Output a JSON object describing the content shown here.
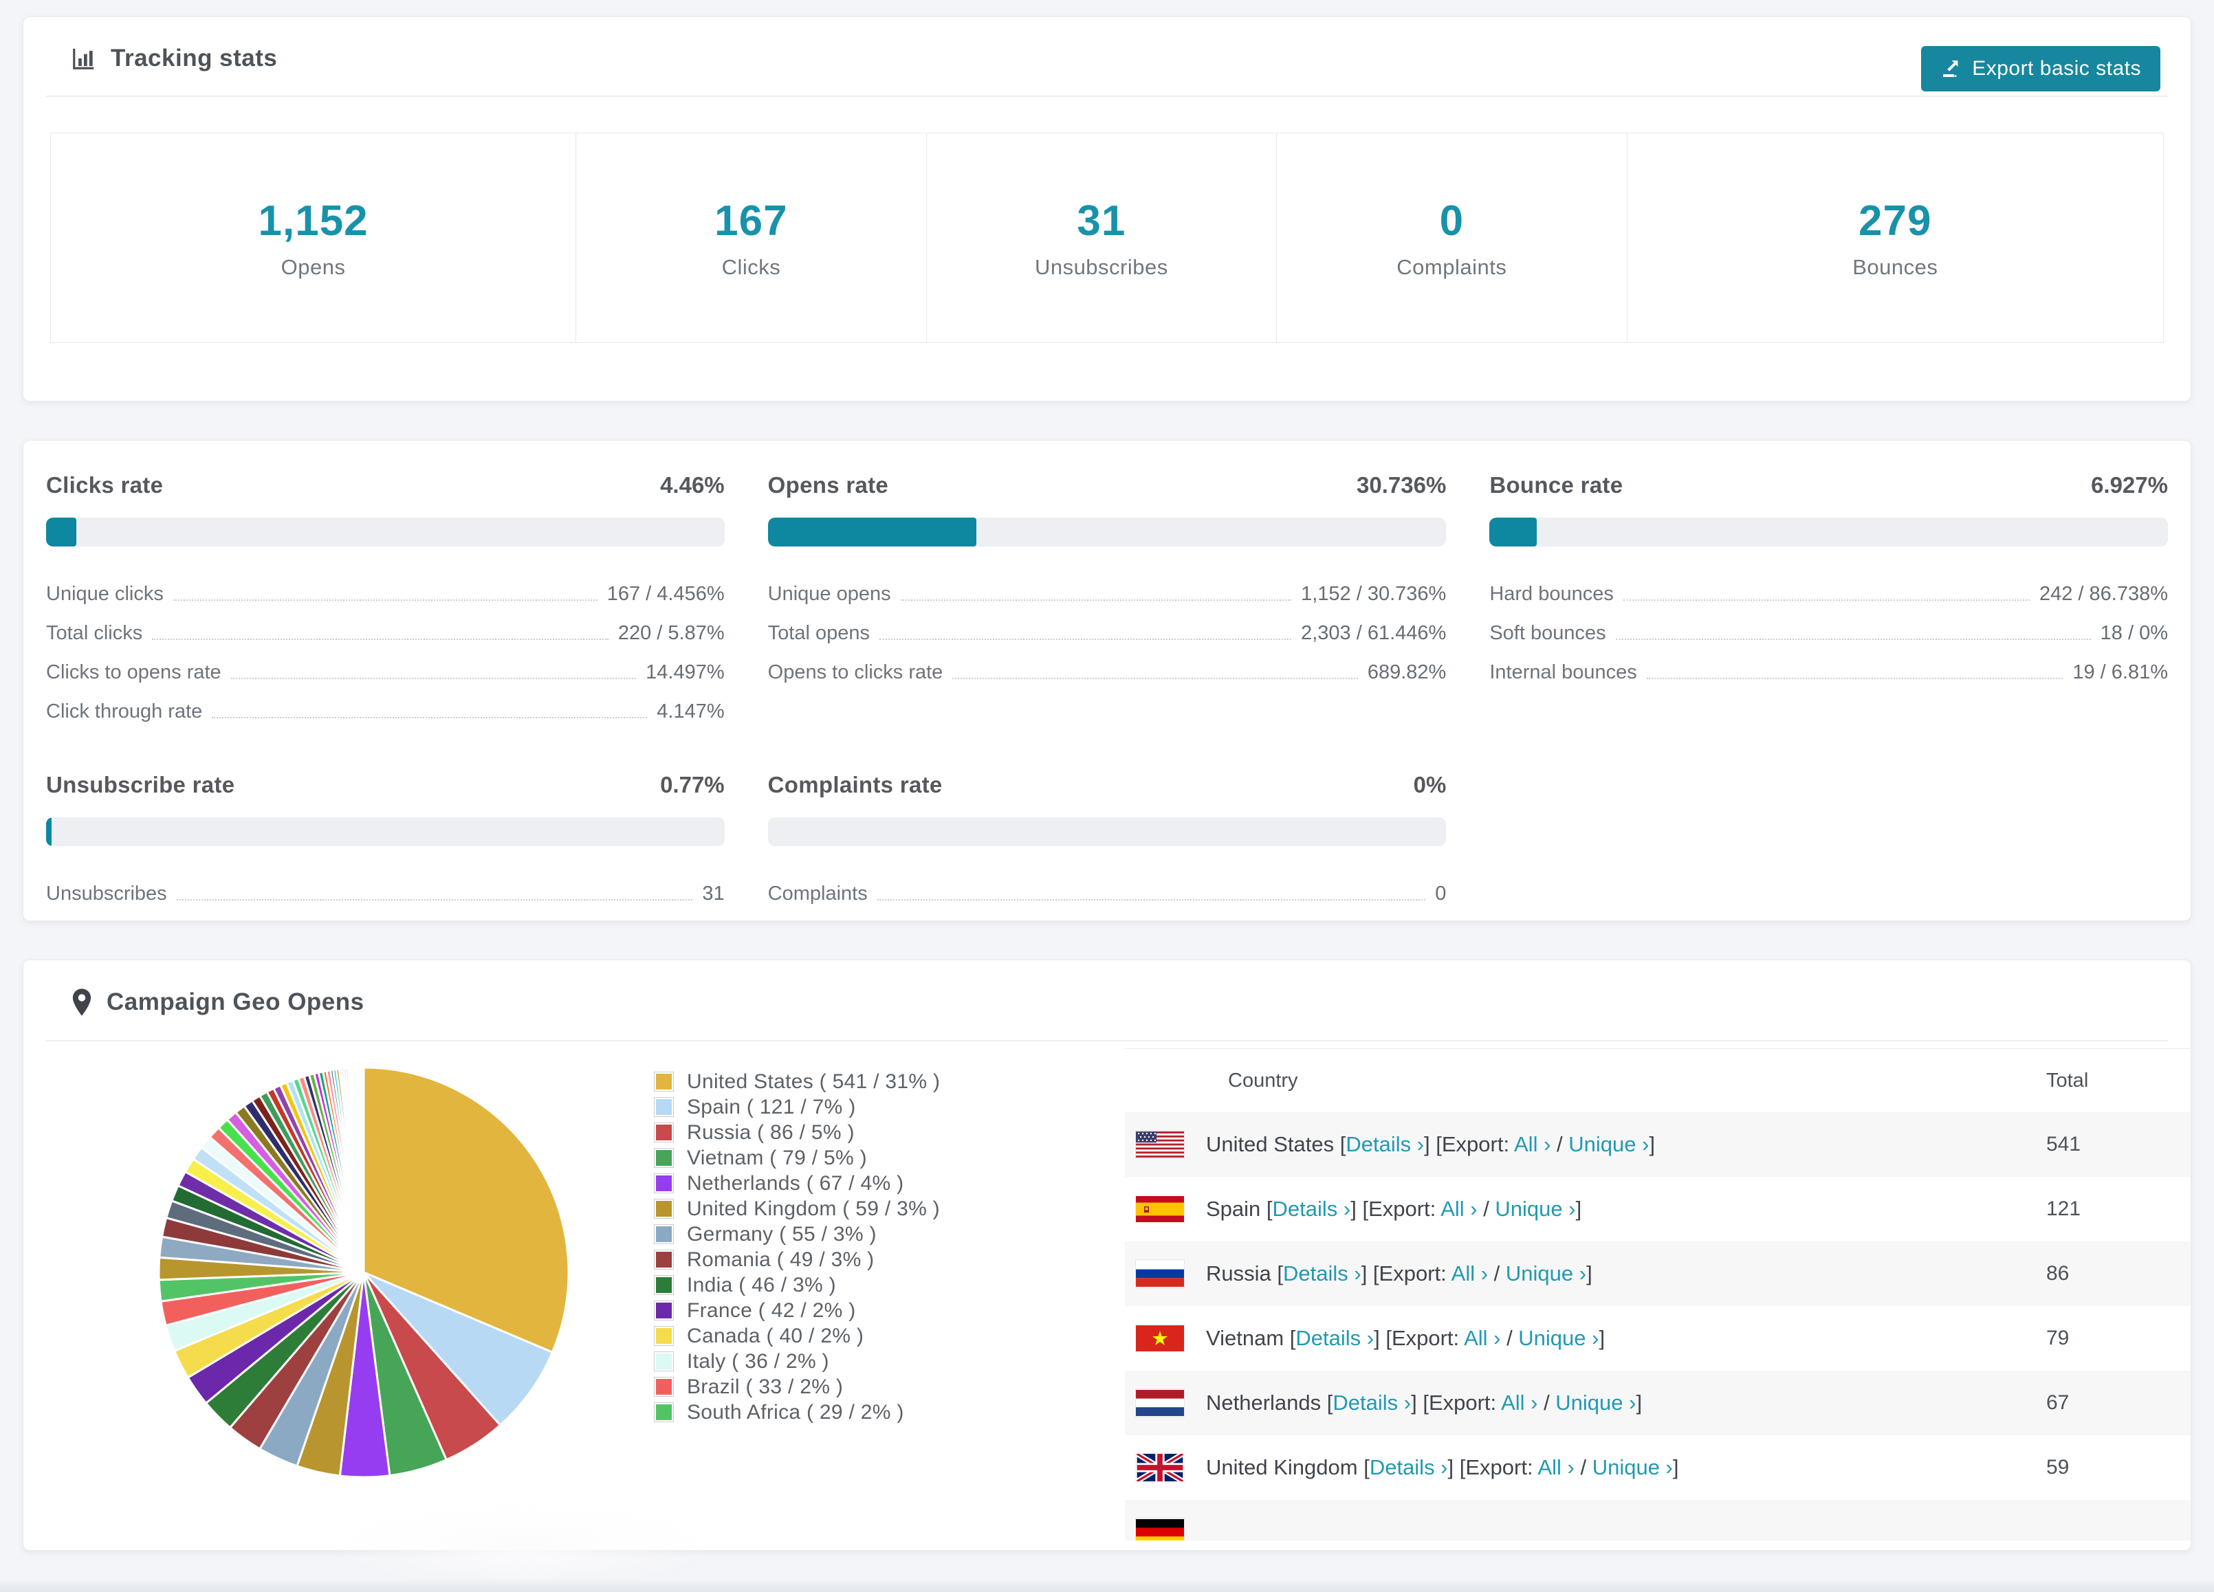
{
  "colors": {
    "accent": "#1792aa",
    "bar_fill": "#0e87a1",
    "button": "#16879e",
    "link": "#2199b1",
    "page_bg": "#f4f5f8",
    "row_stripe": "#f7f7f8"
  },
  "tracking": {
    "title": "Tracking stats",
    "export_button": "Export basic stats",
    "stats": [
      {
        "value": "1,152",
        "label": "Opens"
      },
      {
        "value": "167",
        "label": "Clicks"
      },
      {
        "value": "31",
        "label": "Unsubscribes"
      },
      {
        "value": "0",
        "label": "Complaints"
      },
      {
        "value": "279",
        "label": "Bounces"
      }
    ]
  },
  "rates": [
    {
      "title": "Clicks rate",
      "value": "4.46%",
      "percent": 4.46,
      "rows": [
        {
          "label": "Unique clicks",
          "value": "167 / 4.456%"
        },
        {
          "label": "Total clicks",
          "value": "220 / 5.87%"
        },
        {
          "label": "Clicks to opens rate",
          "value": "14.497%"
        },
        {
          "label": "Click through rate",
          "value": "4.147%"
        }
      ]
    },
    {
      "title": "Opens rate",
      "value": "30.736%",
      "percent": 30.736,
      "rows": [
        {
          "label": "Unique opens",
          "value": "1,152 / 30.736%"
        },
        {
          "label": "Total opens",
          "value": "2,303 / 61.446%"
        },
        {
          "label": "Opens to clicks rate",
          "value": "689.82%"
        }
      ]
    },
    {
      "title": "Bounce rate",
      "value": "6.927%",
      "percent": 6.927,
      "rows": [
        {
          "label": "Hard bounces",
          "value": "242 / 86.738%"
        },
        {
          "label": "Soft bounces",
          "value": "18 / 0%"
        },
        {
          "label": "Internal bounces",
          "value": "19 / 6.81%"
        }
      ]
    },
    {
      "title": "Unsubscribe rate",
      "value": "0.77%",
      "percent": 0.77,
      "rows": [
        {
          "label": "Unsubscribes",
          "value": "31"
        }
      ]
    },
    {
      "title": "Complaints rate",
      "value": "0%",
      "percent": 0,
      "rows": [
        {
          "label": "Complaints",
          "value": "0"
        }
      ]
    }
  ],
  "geo": {
    "title": "Campaign Geo Opens",
    "table": {
      "col_country": "Country",
      "col_total": "Total",
      "tokens": {
        "bracket_open": "[",
        "bracket_close": "]",
        "details": "Details ›",
        "export_word": "Export:",
        "all": "All ›",
        "slash": "/",
        "unique": "Unique ›"
      },
      "rows": [
        {
          "flag": "us",
          "country": "United States",
          "total": "541"
        },
        {
          "flag": "es",
          "country": "Spain",
          "total": "121"
        },
        {
          "flag": "ru",
          "country": "Russia",
          "total": "86"
        },
        {
          "flag": "vn",
          "country": "Vietnam",
          "total": "79"
        },
        {
          "flag": "nl",
          "country": "Netherlands",
          "total": "67"
        },
        {
          "flag": "gb",
          "country": "United Kingdom",
          "total": "59"
        },
        {
          "flag": "de",
          "country": "",
          "total": ""
        }
      ]
    }
  },
  "chart_data": {
    "type": "pie",
    "title": "Campaign Geo Opens",
    "legend_position": "right",
    "start_angle_deg": -90,
    "direction": "clockwise",
    "series": [
      {
        "name": "United States",
        "value": 541,
        "percent_label": "31%",
        "color": "#e2b53e",
        "legend_label": "United States ( 541 / 31% )"
      },
      {
        "name": "Spain",
        "value": 121,
        "percent_label": "7%",
        "color": "#b7d9f4",
        "legend_label": "Spain ( 121 / 7% )"
      },
      {
        "name": "Russia",
        "value": 86,
        "percent_label": "5%",
        "color": "#c94a4c",
        "legend_label": "Russia ( 86 / 5% )"
      },
      {
        "name": "Vietnam",
        "value": 79,
        "percent_label": "5%",
        "color": "#46a557",
        "legend_label": "Vietnam ( 79 / 5% )"
      },
      {
        "name": "Netherlands",
        "value": 67,
        "percent_label": "4%",
        "color": "#963df2",
        "legend_label": "Netherlands ( 67 / 4% )"
      },
      {
        "name": "United Kingdom",
        "value": 59,
        "percent_label": "3%",
        "color": "#b8952e",
        "legend_label": "United Kingdom ( 59 / 3% )"
      },
      {
        "name": "Germany",
        "value": 55,
        "percent_label": "3%",
        "color": "#8ca9c4",
        "legend_label": "Germany ( 55 / 3% )"
      },
      {
        "name": "Romania",
        "value": 49,
        "percent_label": "3%",
        "color": "#9e4040",
        "legend_label": "Romania ( 49 / 3% )"
      },
      {
        "name": "India",
        "value": 46,
        "percent_label": "3%",
        "color": "#2d7d39",
        "legend_label": "India ( 46 / 3% )"
      },
      {
        "name": "France",
        "value": 42,
        "percent_label": "2%",
        "color": "#6b28ab",
        "legend_label": "France ( 42 / 2% )"
      },
      {
        "name": "Canada",
        "value": 40,
        "percent_label": "2%",
        "color": "#f4dc4c",
        "legend_label": "Canada ( 40 / 2% )"
      },
      {
        "name": "Italy",
        "value": 36,
        "percent_label": "2%",
        "color": "#dbfaf4",
        "legend_label": "Italy ( 36 / 2% )"
      },
      {
        "name": "Brazil",
        "value": 33,
        "percent_label": "2%",
        "color": "#f2605e",
        "legend_label": "Brazil ( 33 / 2% )"
      },
      {
        "name": "South Africa",
        "value": 29,
        "percent_label": "2%",
        "color": "#53c465",
        "legend_label": "South Africa ( 29 / 2% )"
      }
    ],
    "others": {
      "note": "unlabeled small slices fanning out counterclockwise toward 12 o'clock, estimated",
      "values": [
        30,
        28,
        26,
        24,
        22,
        21,
        20,
        19,
        18,
        17,
        16,
        15,
        14,
        13,
        12,
        11,
        10,
        10,
        9,
        9,
        8,
        8,
        7,
        7,
        6,
        6,
        5,
        5,
        4,
        4,
        4,
        3,
        3,
        3,
        3,
        2,
        2,
        2,
        2,
        2,
        2,
        1,
        1,
        1,
        1,
        1,
        1,
        1,
        1,
        1
      ],
      "palette": [
        "#b8962e",
        "#8fa9c2",
        "#8e3a3a",
        "#5d6d7e",
        "#226b33",
        "#6f2da8",
        "#f7ef4a",
        "#bfe0f7",
        "#ecfbf9",
        "#f2706e",
        "#49e04e",
        "#d65ee0",
        "#8a7a20",
        "#2e2e6e",
        "#7b241c",
        "#3f9d5a",
        "#c0392b",
        "#8e44ad",
        "#f1c40f",
        "#aee4f2",
        "#58d68d",
        "#ff8a80",
        "#30336b",
        "#6ab04c",
        "#be2edd",
        "#16a085",
        "#e67e22",
        "#fd79a8",
        "#636e72",
        "#00cec9"
      ]
    }
  }
}
